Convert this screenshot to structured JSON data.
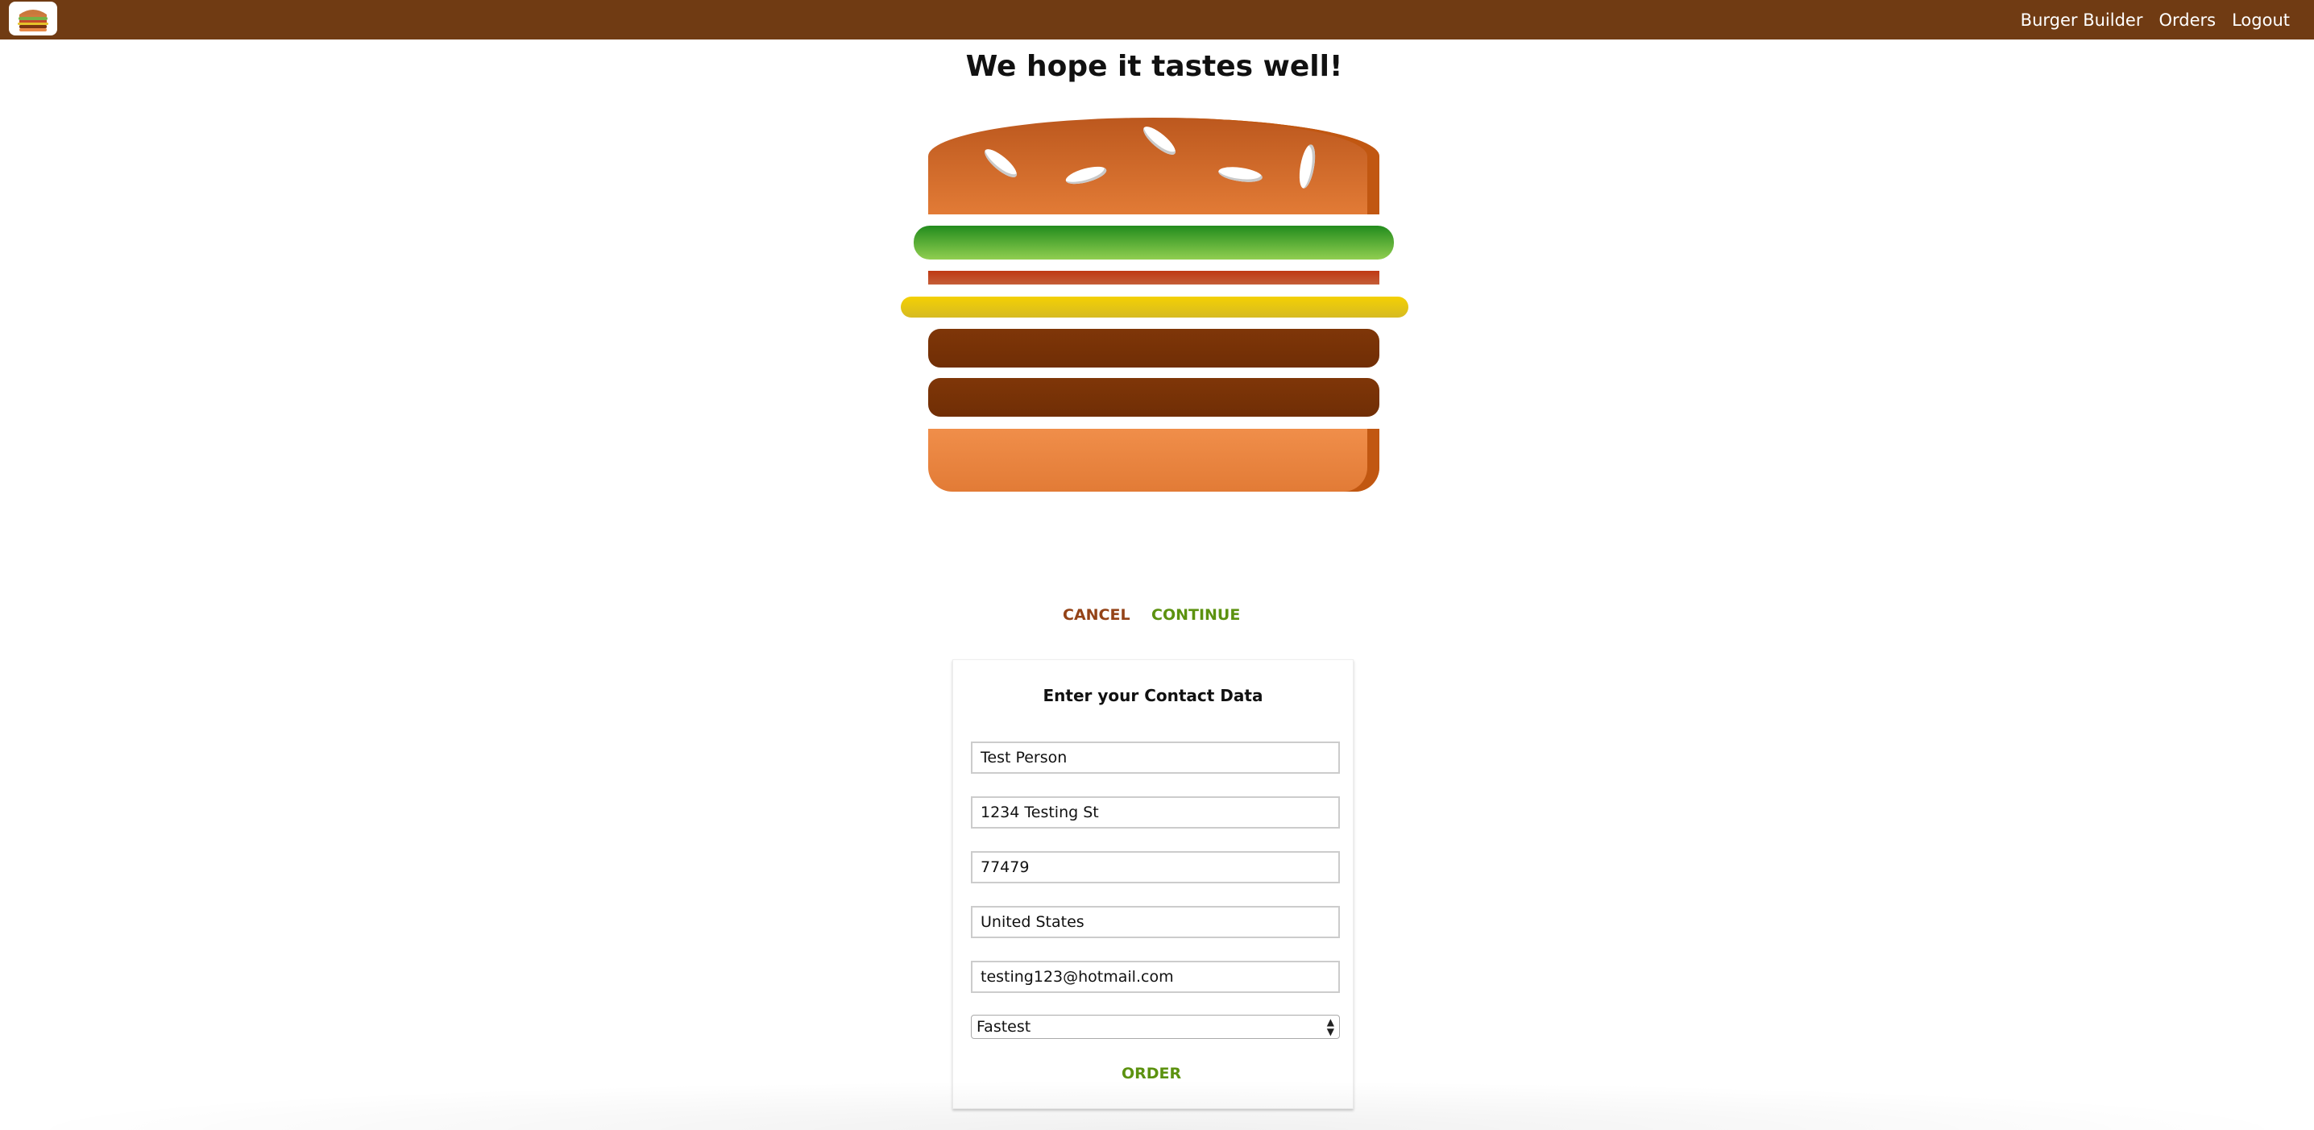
{
  "toolbar": {
    "logo_alt": "burger-logo",
    "nav": [
      {
        "label": "Burger Builder"
      },
      {
        "label": "Orders"
      },
      {
        "label": "Logout"
      }
    ]
  },
  "checkout": {
    "heading": "We hope it tastes well!",
    "ingredients": [
      "salad",
      "bacon",
      "cheese",
      "meat",
      "meat"
    ],
    "cancel_label": "CANCEL",
    "continue_label": "CONTINUE"
  },
  "contact": {
    "title": "Enter your Contact Data",
    "name": "Test Person",
    "street": "1234 Testing St",
    "zip": "77479",
    "country": "United States",
    "email": "testing123@hotmail.com",
    "delivery_method": "Fastest",
    "order_label": "ORDER"
  },
  "colors": {
    "toolbar": "#703b13",
    "cancel": "#944317",
    "success": "#5c9210"
  }
}
